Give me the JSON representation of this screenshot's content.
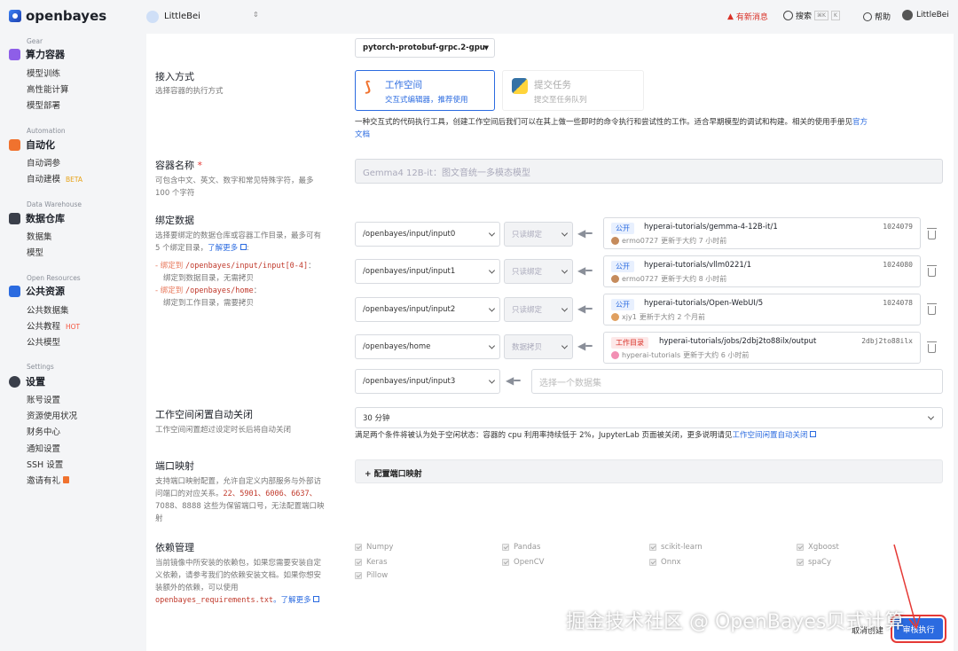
{
  "brand": {
    "name": "openbayes"
  },
  "workspace": {
    "name": "LittleBei"
  },
  "topbar": {
    "notice": "有新消息",
    "search": "搜索",
    "kbd1": "⌘K",
    "kbd2": "K",
    "help": "帮助",
    "user": "LittleBei"
  },
  "sidebar": {
    "groups": [
      {
        "label": "Gear",
        "title": "算力容器",
        "items": [
          "模型训练",
          "高性能计算",
          "模型部署"
        ]
      },
      {
        "label": "Automation",
        "title": "自动化",
        "items": [
          "自动调参",
          "自动建模"
        ],
        "beta": "BETA"
      },
      {
        "label": "Data Warehouse",
        "title": "数据仓库",
        "items": [
          "数据集",
          "模型"
        ]
      },
      {
        "label": "Open Resources",
        "title": "公共资源",
        "items": [
          "公共数据集",
          "公共教程",
          "公共模型"
        ],
        "hot": "HOT"
      },
      {
        "label": "Settings",
        "title": "设置",
        "items": [
          "账号设置",
          "资源使用状况",
          "财务中心",
          "通知设置",
          "SSH 设置",
          "邀请有礼"
        ]
      }
    ]
  },
  "image_select": {
    "value": "pytorch-protobuf-grpc.2-gpu"
  },
  "access": {
    "title": "接入方式",
    "desc": "选择容器的执行方式",
    "workspace": {
      "title": "工作空间",
      "sub": "交互式编辑器，推荐使用"
    },
    "task": {
      "title": "提交任务",
      "sub": "提交至任务队列"
    },
    "note": "一种交互式的代码执行工具，创建工作空间后我们可以在其上做一些即时的命令执行和尝试性的工作。适合早期模型的调试和构建。相关的使用手册见",
    "note_link1": "官方",
    "note_link2": "文档"
  },
  "container_name": {
    "title": "容器名称",
    "req": "*",
    "desc1": "可包含中文、英文、数字和常见特殊字符，最多",
    "desc2": "100 个字符",
    "value": "Gemma4 12B-it：图文音统一多模态模型"
  },
  "bind": {
    "title": "绑定数据",
    "desc1": "选择要绑定的数据仓库或容器工作目录，最多可有",
    "desc2": "5 个绑定目录，",
    "more": "了解更多",
    "hint1a": "- 绑定到",
    "hint1b": "/openbayes/input/input[0-4]",
    "hint1c": "：",
    "hint1d": "绑定到数据目录，无需拷贝",
    "hint2a": "- 绑定到",
    "hint2b": "/openbayes/home",
    "hint2c": "：",
    "hint2d": "绑定到工作目录，需要拷贝",
    "rows": [
      {
        "path": "/openbayes/input/input0",
        "mode": "只读绑定",
        "tag": "公开",
        "name": "hyperai-tutorials/gemma-4-12B-it/1",
        "id": "1024079",
        "owner": "ermo0727",
        "updated": "更新于大约 7 小时前"
      },
      {
        "path": "/openbayes/input/input1",
        "mode": "只读绑定",
        "tag": "公开",
        "name": "hyperai-tutorials/vllm0221/1",
        "id": "1024080",
        "owner": "ermo0727",
        "updated": "更新于大约 8 小时前"
      },
      {
        "path": "/openbayes/input/input2",
        "mode": "只读绑定",
        "tag": "公开",
        "name": "hyperai-tutorials/Open-WebUI/5",
        "id": "1024078",
        "owner": "xjy1",
        "updated": "更新于大约 2 个月前"
      },
      {
        "path": "/openbayes/home",
        "mode": "数据拷贝",
        "tag": "工作目录",
        "name": "hyperai-tutorials/jobs/2dbj2to88ilx/output",
        "id": "2dbj2to88ilx",
        "owner": "hyperai-tutorials",
        "updated": "更新于大约 6 小时前"
      }
    ],
    "empty_path": "/openbayes/input/input3",
    "empty_placeholder": "选择一个数据集"
  },
  "idle": {
    "title": "工作空间闲置自动关闭",
    "desc": "工作空间闲置超过设定时长后将自动关闭",
    "value": "30 分钟",
    "note": "满足两个条件将被认为处于空闲状态：容器的 cpu 利用率持续低于 2%，JupyterLab 页面被关闭，更多说明请见",
    "link": "工作空间闲置自动关闭"
  },
  "ports": {
    "title": "端口映射",
    "desc1": "支持端口映射配置，允许自定义内部服务与外部访",
    "desc2": "问端口的对应关系。",
    "desc3": "22、5901、6006、6637、",
    "desc4": "7088、8888 这些为保留端口号，无法配置端口映",
    "desc5": "射",
    "button": "+ 配置端口映射"
  },
  "deps": {
    "title": "依赖管理",
    "desc1": "当前镜像中所安装的依赖包，如果您需要安装自定",
    "desc2": "义依赖，请参考我们的依赖安装文档。如果你想安",
    "desc3": "装额外的依赖，可以使用",
    "file": "openbayes_requirements.txt",
    "more": "。了解更多",
    "packages": [
      "Numpy",
      "Pandas",
      "scikit-learn",
      "Xgboost",
      "Keras",
      "OpenCV",
      "Onnx",
      "spaCy",
      "Pillow"
    ]
  },
  "footer": {
    "cancel": "取消创建",
    "submit": "审核执行"
  },
  "watermark": "掘金技术社区 @ OpenBayes贝式计算"
}
